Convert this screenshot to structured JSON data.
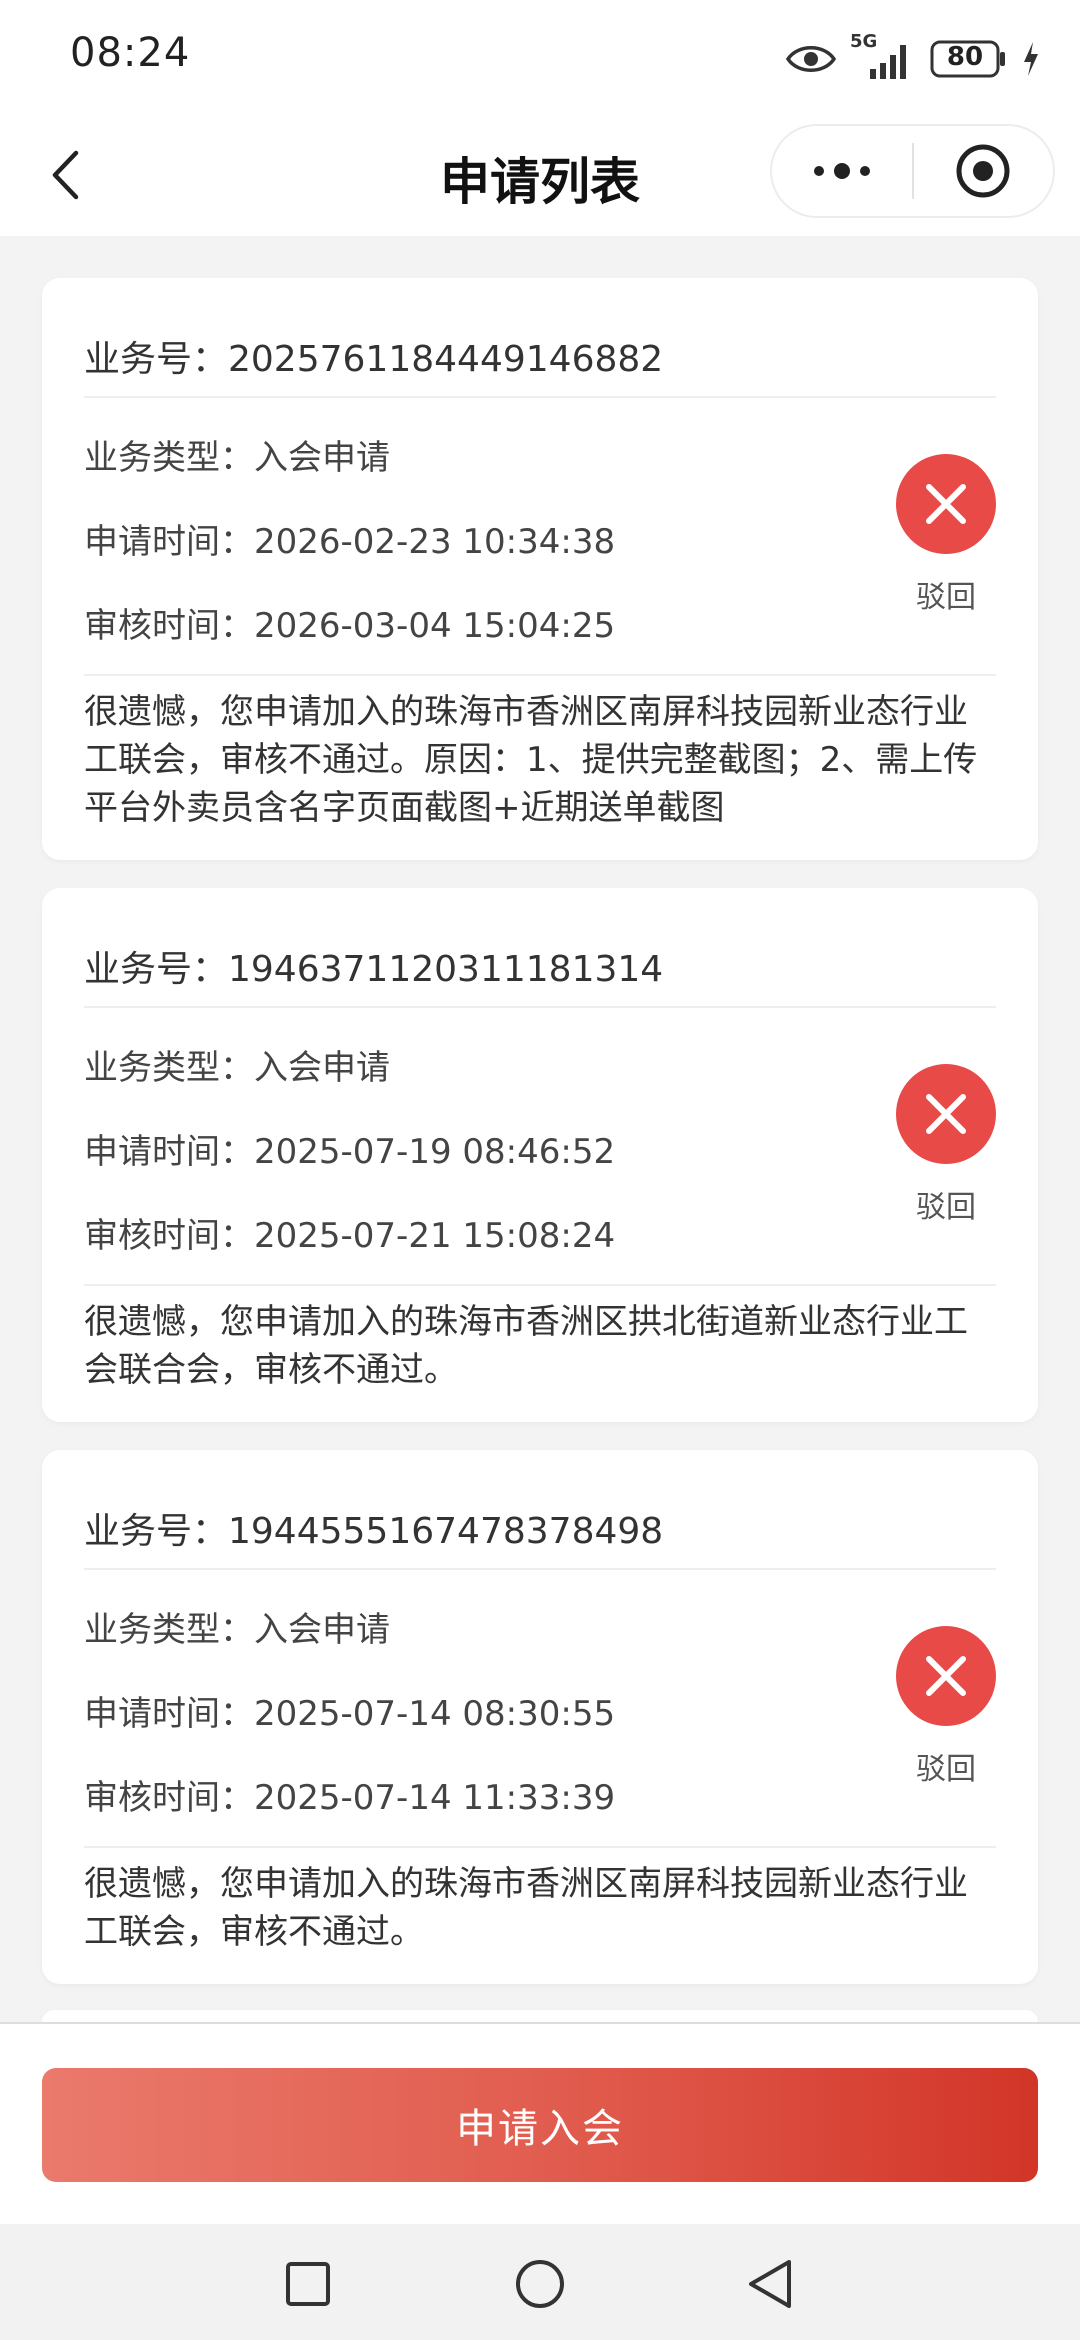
{
  "status_bar": {
    "time": "08:24",
    "network": "5G",
    "battery": "80",
    "icons": [
      "eye-icon",
      "signal-icon",
      "battery-icon",
      "charging-icon"
    ]
  },
  "header": {
    "title": "申请列表",
    "back_icon": "chevron-left-icon",
    "more_icon": "more-dots-icon",
    "close_icon": "target-icon"
  },
  "colors": {
    "reject_red": "#e84a48",
    "button_gradient_start": "#ea7a6c",
    "button_gradient_end": "#d23528"
  },
  "applications": [
    {
      "id_label": "业务号：2025761184449146882",
      "type": "业务类型：入会申请",
      "apply_time": "申请时间：2026-02-23 10:34:38",
      "review_time": "审核时间：2026-03-04 15:04:25",
      "status": "驳回",
      "reason": "很遗憾，您申请加入的珠海市香洲区南屏科技园新业态行业工联会，审核不通过。原因：1、提供完整截图；2、需上传平台外卖员含名字页面截图+近期送单截图"
    },
    {
      "id_label": "业务号：1946371120311181314",
      "type": "业务类型：入会申请",
      "apply_time": "申请时间：2025-07-19 08:46:52",
      "review_time": "审核时间：2025-07-21 15:08:24",
      "status": "驳回",
      "reason": "很遗憾，您申请加入的珠海市香洲区拱北街道新业态行业工会联合会，审核不通过。"
    },
    {
      "id_label": "业务号：1944555167478378498",
      "type": "业务类型：入会申请",
      "apply_time": "申请时间：2025-07-14 08:30:55",
      "review_time": "审核时间：2025-07-14 11:33:39",
      "status": "驳回",
      "reason": "很遗憾，您申请加入的珠海市香洲区南屏科技园新业态行业工联会，审核不通过。"
    }
  ],
  "footer": {
    "apply_button": "申请入会"
  },
  "nav_bar": {
    "icons": [
      "recent-apps-icon",
      "home-icon",
      "back-icon"
    ]
  }
}
